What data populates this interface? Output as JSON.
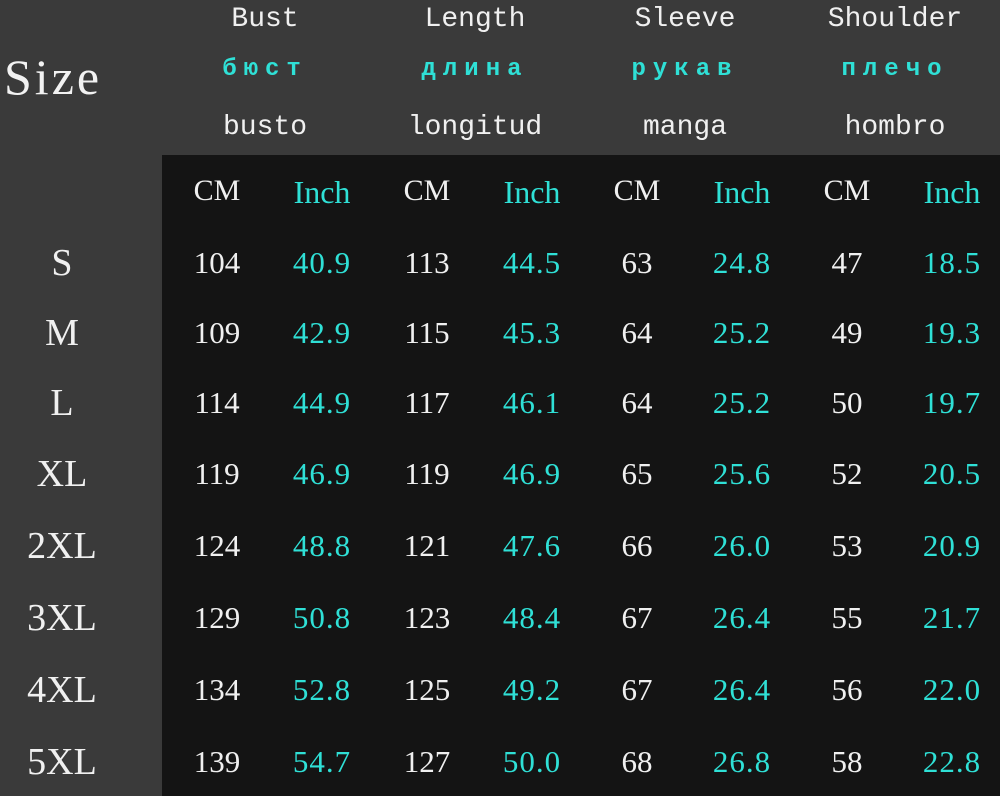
{
  "size_label": "Size",
  "measures": [
    {
      "en": "Bust",
      "ru": "бюст",
      "es": "busto"
    },
    {
      "en": "Length",
      "ru": "длина",
      "es": "longitud"
    },
    {
      "en": "Sleeve",
      "ru": "рукав",
      "es": "manga"
    },
    {
      "en": "Shoulder",
      "ru": "плечо",
      "es": "hombro"
    }
  ],
  "unit_labels": {
    "cm": "CM",
    "inch": "Inch"
  },
  "colors": {
    "background": "#3a3a3a",
    "panel": "#141414",
    "text": "#f0f0f0",
    "accent": "#2fe0d6"
  },
  "chart_data": {
    "type": "table",
    "columns": [
      "Size",
      "Bust CM",
      "Bust Inch",
      "Length CM",
      "Length Inch",
      "Sleeve CM",
      "Sleeve Inch",
      "Shoulder CM",
      "Shoulder Inch"
    ],
    "rows": [
      {
        "size": "S",
        "values": [
          "104",
          "40.9",
          "113",
          "44.5",
          "63",
          "24.8",
          "47",
          "18.5"
        ]
      },
      {
        "size": "M",
        "values": [
          "109",
          "42.9",
          "115",
          "45.3",
          "64",
          "25.2",
          "49",
          "19.3"
        ]
      },
      {
        "size": "L",
        "values": [
          "114",
          "44.9",
          "117",
          "46.1",
          "64",
          "25.2",
          "50",
          "19.7"
        ]
      },
      {
        "size": "XL",
        "values": [
          "119",
          "46.9",
          "119",
          "46.9",
          "65",
          "25.6",
          "52",
          "20.5"
        ]
      },
      {
        "size": "2XL",
        "values": [
          "124",
          "48.8",
          "121",
          "47.6",
          "66",
          "26.0",
          "53",
          "20.9"
        ]
      },
      {
        "size": "3XL",
        "values": [
          "129",
          "50.8",
          "123",
          "48.4",
          "67",
          "26.4",
          "55",
          "21.7"
        ]
      },
      {
        "size": "4XL",
        "values": [
          "134",
          "52.8",
          "125",
          "49.2",
          "67",
          "26.4",
          "56",
          "22.0"
        ]
      },
      {
        "size": "5XL",
        "values": [
          "139",
          "54.7",
          "127",
          "50.0",
          "68",
          "26.8",
          "58",
          "22.8"
        ]
      }
    ]
  }
}
